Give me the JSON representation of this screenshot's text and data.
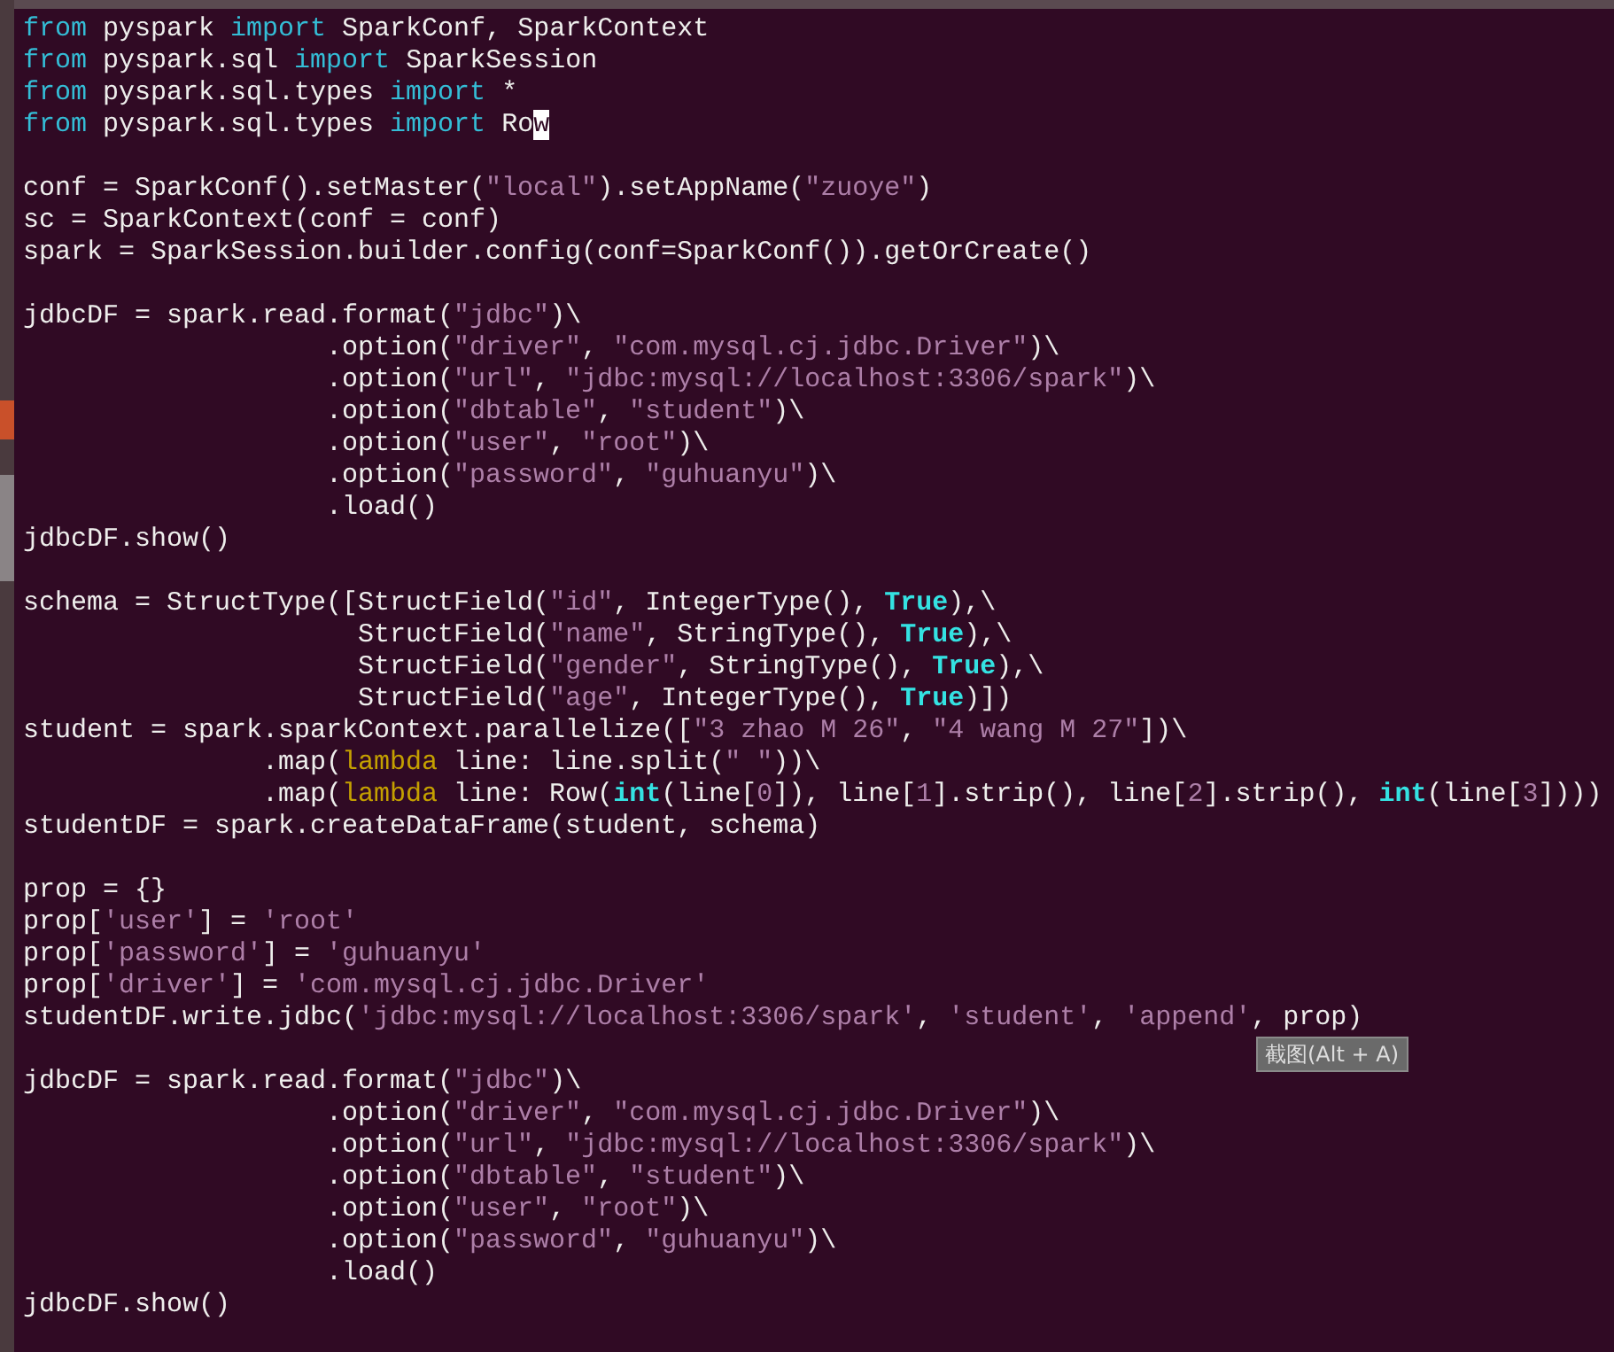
{
  "editor": {
    "lines": [
      {
        "kind": "code",
        "segments": [
          {
            "kind": "keyword",
            "text": "from"
          },
          {
            "kind": "plain",
            "text": " pyspark "
          },
          {
            "kind": "keyword",
            "text": "import"
          },
          {
            "kind": "plain",
            "text": " SparkConf, SparkContext"
          }
        ]
      },
      {
        "kind": "code",
        "segments": [
          {
            "kind": "keyword",
            "text": "from"
          },
          {
            "kind": "plain",
            "text": " pyspark.sql "
          },
          {
            "kind": "keyword",
            "text": "import"
          },
          {
            "kind": "plain",
            "text": " SparkSession"
          }
        ]
      },
      {
        "kind": "code",
        "segments": [
          {
            "kind": "keyword",
            "text": "from"
          },
          {
            "kind": "plain",
            "text": " pyspark.sql.types "
          },
          {
            "kind": "keyword",
            "text": "import"
          },
          {
            "kind": "plain",
            "text": " *"
          }
        ]
      },
      {
        "kind": "code",
        "segments": [
          {
            "kind": "keyword",
            "text": "from"
          },
          {
            "kind": "plain",
            "text": " pyspark.sql.types "
          },
          {
            "kind": "keyword",
            "text": "import"
          },
          {
            "kind": "plain",
            "text": " Ro"
          },
          {
            "kind": "cursor",
            "text": "w"
          }
        ]
      },
      {
        "kind": "blank"
      },
      {
        "kind": "code",
        "segments": [
          {
            "kind": "plain",
            "text": "conf = SparkConf().setMaster("
          },
          {
            "kind": "string",
            "text": "\"local\""
          },
          {
            "kind": "plain",
            "text": ").setAppName("
          },
          {
            "kind": "string",
            "text": "\"zuoye\""
          },
          {
            "kind": "plain",
            "text": ")"
          }
        ]
      },
      {
        "kind": "code",
        "segments": [
          {
            "kind": "plain",
            "text": "sc = SparkContext(conf = conf)"
          }
        ]
      },
      {
        "kind": "code",
        "segments": [
          {
            "kind": "plain",
            "text": "spark = SparkSession.builder.config(conf=SparkConf()).getOrCreate()"
          }
        ]
      },
      {
        "kind": "blank"
      },
      {
        "kind": "code",
        "segments": [
          {
            "kind": "plain",
            "text": "jdbcDF = spark.read.format("
          },
          {
            "kind": "string",
            "text": "\"jdbc\""
          },
          {
            "kind": "plain",
            "text": ")\\"
          }
        ]
      },
      {
        "kind": "code",
        "segments": [
          {
            "kind": "plain",
            "text": "                   .option("
          },
          {
            "kind": "string",
            "text": "\"driver\""
          },
          {
            "kind": "plain",
            "text": ", "
          },
          {
            "kind": "string",
            "text": "\"com.mysql.cj.jdbc.Driver\""
          },
          {
            "kind": "plain",
            "text": ")\\"
          }
        ]
      },
      {
        "kind": "code",
        "segments": [
          {
            "kind": "plain",
            "text": "                   .option("
          },
          {
            "kind": "string",
            "text": "\"url\""
          },
          {
            "kind": "plain",
            "text": ", "
          },
          {
            "kind": "string",
            "text": "\"jdbc:mysql://localhost:3306/spark\""
          },
          {
            "kind": "plain",
            "text": ")\\"
          }
        ]
      },
      {
        "kind": "code",
        "segments": [
          {
            "kind": "plain",
            "text": "                   .option("
          },
          {
            "kind": "string",
            "text": "\"dbtable\""
          },
          {
            "kind": "plain",
            "text": ", "
          },
          {
            "kind": "string",
            "text": "\"student\""
          },
          {
            "kind": "plain",
            "text": ")\\"
          }
        ]
      },
      {
        "kind": "code",
        "segments": [
          {
            "kind": "plain",
            "text": "                   .option("
          },
          {
            "kind": "string",
            "text": "\"user\""
          },
          {
            "kind": "plain",
            "text": ", "
          },
          {
            "kind": "string",
            "text": "\"root\""
          },
          {
            "kind": "plain",
            "text": ")\\"
          }
        ]
      },
      {
        "kind": "code",
        "segments": [
          {
            "kind": "plain",
            "text": "                   .option("
          },
          {
            "kind": "string",
            "text": "\"password\""
          },
          {
            "kind": "plain",
            "text": ", "
          },
          {
            "kind": "string",
            "text": "\"guhuanyu\""
          },
          {
            "kind": "plain",
            "text": ")\\"
          }
        ]
      },
      {
        "kind": "code",
        "segments": [
          {
            "kind": "plain",
            "text": "                   .load()"
          }
        ]
      },
      {
        "kind": "code",
        "segments": [
          {
            "kind": "plain",
            "text": "jdbcDF.show()"
          }
        ]
      },
      {
        "kind": "blank"
      },
      {
        "kind": "code",
        "segments": [
          {
            "kind": "plain",
            "text": "schema = StructType([StructField("
          },
          {
            "kind": "string",
            "text": "\"id\""
          },
          {
            "kind": "plain",
            "text": ", IntegerType(), "
          },
          {
            "kind": "builtin",
            "text": "True"
          },
          {
            "kind": "plain",
            "text": "),\\"
          }
        ]
      },
      {
        "kind": "code",
        "segments": [
          {
            "kind": "plain",
            "text": "                     StructField("
          },
          {
            "kind": "string",
            "text": "\"name\""
          },
          {
            "kind": "plain",
            "text": ", StringType(), "
          },
          {
            "kind": "builtin",
            "text": "True"
          },
          {
            "kind": "plain",
            "text": "),\\"
          }
        ]
      },
      {
        "kind": "code",
        "segments": [
          {
            "kind": "plain",
            "text": "                     StructField("
          },
          {
            "kind": "string",
            "text": "\"gender\""
          },
          {
            "kind": "plain",
            "text": ", StringType(), "
          },
          {
            "kind": "builtin",
            "text": "True"
          },
          {
            "kind": "plain",
            "text": "),\\"
          }
        ]
      },
      {
        "kind": "code",
        "segments": [
          {
            "kind": "plain",
            "text": "                     StructField("
          },
          {
            "kind": "string",
            "text": "\"age\""
          },
          {
            "kind": "plain",
            "text": ", IntegerType(), "
          },
          {
            "kind": "builtin",
            "text": "True"
          },
          {
            "kind": "plain",
            "text": ")])"
          }
        ]
      },
      {
        "kind": "code",
        "segments": [
          {
            "kind": "plain",
            "text": "student = spark.sparkContext.parallelize(["
          },
          {
            "kind": "string",
            "text": "\"3 zhao M 26\""
          },
          {
            "kind": "plain",
            "text": ", "
          },
          {
            "kind": "string",
            "text": "\"4 wang M 27\""
          },
          {
            "kind": "plain",
            "text": "])\\"
          }
        ]
      },
      {
        "kind": "code",
        "segments": [
          {
            "kind": "plain",
            "text": "               .map("
          },
          {
            "kind": "lambda",
            "text": "lambda"
          },
          {
            "kind": "plain",
            "text": " line: line.split("
          },
          {
            "kind": "string",
            "text": "\" \""
          },
          {
            "kind": "plain",
            "text": "))\\"
          }
        ]
      },
      {
        "kind": "code",
        "segments": [
          {
            "kind": "plain",
            "text": "               .map("
          },
          {
            "kind": "lambda",
            "text": "lambda"
          },
          {
            "kind": "plain",
            "text": " line: Row("
          },
          {
            "kind": "builtin",
            "text": "int"
          },
          {
            "kind": "plain",
            "text": "(line["
          },
          {
            "kind": "string",
            "text": "0"
          },
          {
            "kind": "plain",
            "text": "]), line["
          },
          {
            "kind": "string",
            "text": "1"
          },
          {
            "kind": "plain",
            "text": "].strip(), line["
          },
          {
            "kind": "string",
            "text": "2"
          },
          {
            "kind": "plain",
            "text": "].strip(), "
          },
          {
            "kind": "builtin",
            "text": "int"
          },
          {
            "kind": "plain",
            "text": "(line["
          },
          {
            "kind": "string",
            "text": "3"
          },
          {
            "kind": "plain",
            "text": "])))"
          }
        ]
      },
      {
        "kind": "code",
        "segments": [
          {
            "kind": "plain",
            "text": "studentDF = spark.createDataFrame(student, schema)"
          }
        ]
      },
      {
        "kind": "blank"
      },
      {
        "kind": "code",
        "segments": [
          {
            "kind": "plain",
            "text": "prop = {}"
          }
        ]
      },
      {
        "kind": "code",
        "segments": [
          {
            "kind": "plain",
            "text": "prop["
          },
          {
            "kind": "string",
            "text": "'user'"
          },
          {
            "kind": "plain",
            "text": "] = "
          },
          {
            "kind": "string",
            "text": "'root'"
          }
        ]
      },
      {
        "kind": "code",
        "segments": [
          {
            "kind": "plain",
            "text": "prop["
          },
          {
            "kind": "string",
            "text": "'password'"
          },
          {
            "kind": "plain",
            "text": "] = "
          },
          {
            "kind": "string",
            "text": "'guhuanyu'"
          }
        ]
      },
      {
        "kind": "code",
        "segments": [
          {
            "kind": "plain",
            "text": "prop["
          },
          {
            "kind": "string",
            "text": "'driver'"
          },
          {
            "kind": "plain",
            "text": "] = "
          },
          {
            "kind": "string",
            "text": "'com.mysql.cj.jdbc.Driver'"
          }
        ]
      },
      {
        "kind": "code",
        "segments": [
          {
            "kind": "plain",
            "text": "studentDF.write.jdbc("
          },
          {
            "kind": "string",
            "text": "'jdbc:mysql://localhost:3306/spark'"
          },
          {
            "kind": "plain",
            "text": ", "
          },
          {
            "kind": "string",
            "text": "'student'"
          },
          {
            "kind": "plain",
            "text": ", "
          },
          {
            "kind": "string",
            "text": "'append'"
          },
          {
            "kind": "plain",
            "text": ", prop)"
          }
        ]
      },
      {
        "kind": "blank"
      },
      {
        "kind": "code",
        "segments": [
          {
            "kind": "plain",
            "text": "jdbcDF = spark.read.format("
          },
          {
            "kind": "string",
            "text": "\"jdbc\""
          },
          {
            "kind": "plain",
            "text": ")\\"
          }
        ]
      },
      {
        "kind": "code",
        "segments": [
          {
            "kind": "plain",
            "text": "                   .option("
          },
          {
            "kind": "string",
            "text": "\"driver\""
          },
          {
            "kind": "plain",
            "text": ", "
          },
          {
            "kind": "string",
            "text": "\"com.mysql.cj.jdbc.Driver\""
          },
          {
            "kind": "plain",
            "text": ")\\"
          }
        ]
      },
      {
        "kind": "code",
        "segments": [
          {
            "kind": "plain",
            "text": "                   .option("
          },
          {
            "kind": "string",
            "text": "\"url\""
          },
          {
            "kind": "plain",
            "text": ", "
          },
          {
            "kind": "string",
            "text": "\"jdbc:mysql://localhost:3306/spark\""
          },
          {
            "kind": "plain",
            "text": ")\\"
          }
        ]
      },
      {
        "kind": "code",
        "segments": [
          {
            "kind": "plain",
            "text": "                   .option("
          },
          {
            "kind": "string",
            "text": "\"dbtable\""
          },
          {
            "kind": "plain",
            "text": ", "
          },
          {
            "kind": "string",
            "text": "\"student\""
          },
          {
            "kind": "plain",
            "text": ")\\"
          }
        ]
      },
      {
        "kind": "code",
        "segments": [
          {
            "kind": "plain",
            "text": "                   .option("
          },
          {
            "kind": "string",
            "text": "\"user\""
          },
          {
            "kind": "plain",
            "text": ", "
          },
          {
            "kind": "string",
            "text": "\"root\""
          },
          {
            "kind": "plain",
            "text": ")\\"
          }
        ]
      },
      {
        "kind": "code",
        "segments": [
          {
            "kind": "plain",
            "text": "                   .option("
          },
          {
            "kind": "string",
            "text": "\"password\""
          },
          {
            "kind": "plain",
            "text": ", "
          },
          {
            "kind": "string",
            "text": "\"guhuanyu\""
          },
          {
            "kind": "plain",
            "text": ")\\"
          }
        ]
      },
      {
        "kind": "code",
        "segments": [
          {
            "kind": "plain",
            "text": "                   .load()"
          }
        ]
      },
      {
        "kind": "code",
        "segments": [
          {
            "kind": "plain",
            "text": "jdbcDF.show()"
          }
        ]
      }
    ]
  },
  "tooltip": {
    "text": "截图(Alt + A)"
  }
}
